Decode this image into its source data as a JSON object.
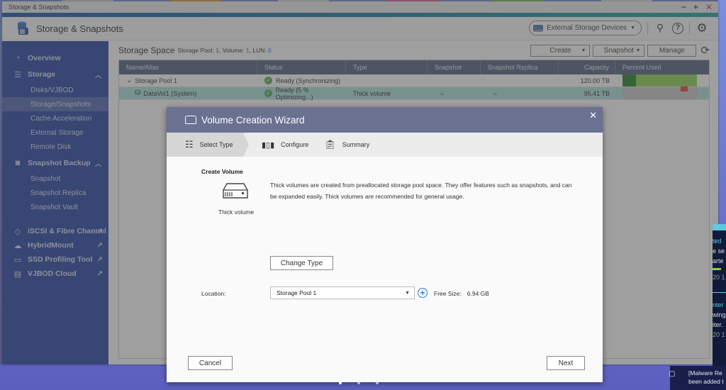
{
  "window": {
    "title": "Storage & Snapshots",
    "controls": {
      "minimize": "−",
      "maximize": "+",
      "close": "✕"
    }
  },
  "header": {
    "app_title": "Storage & Snapshots",
    "external_devices_label": "External Storage Devices",
    "icons": [
      "diagnostics-icon",
      "help-icon",
      "settings-icon"
    ]
  },
  "sidebar": {
    "overview": "Overview",
    "storage": "Storage",
    "storage_items": [
      "Disks/VJBOD",
      "Storage/Snapshots",
      "Cache Acceleration",
      "External Storage",
      "Remote Disk"
    ],
    "snapshot_backup": "Snapshot Backup",
    "snapshot_items": [
      "Snapshot",
      "Snapshot Replica",
      "Snapshot Vault"
    ],
    "external_tools": [
      "iSCSI & Fibre Channel",
      "HybridMount",
      "SSD Profiling Tool",
      "VJBOD Cloud"
    ],
    "active_item": "Storage/Snapshots"
  },
  "content": {
    "title": "Storage Space",
    "summary_prefix_pool": "Storage Pool:",
    "pool_count": "1",
    "summary_volume": ", Volume:",
    "volume_count": "1",
    "summary_lun": ", LUN:",
    "lun_count": "0",
    "toolbar": {
      "create": "Create",
      "snapshot": "Snapshot",
      "manage": "Manage"
    },
    "columns": [
      "Name/Alias",
      "Status",
      "Type",
      "Snapshot",
      "Snapshot Replica",
      "Capacity",
      "Percent Used"
    ],
    "rows": [
      {
        "name": "Storage Pool 1",
        "status": "Ready (Synchronizing)",
        "type": "",
        "snapshot": "",
        "replica": "",
        "capacity": "120.00 TB",
        "percent_used": 0.18,
        "bar_fill": 1.0
      },
      {
        "name": "DataVol1 (System)",
        "status": "Ready (5 % Optimizing...)",
        "type": "Thick volume",
        "snapshot": "–",
        "replica": "–",
        "capacity": "95.41 TB",
        "marker": 0.78
      }
    ]
  },
  "wizard": {
    "title": "Volume Creation Wizard",
    "steps": [
      "Select Type",
      "Configure",
      "Summary"
    ],
    "active_step": "Select Type",
    "section_label": "Create Volume",
    "volume_type": "Thick volume",
    "description": "Thick volumes are created from preallocated storage pool space. They offer features such as snapshots, and can be expanded easily. Thick volumes are recommended for general usage.",
    "change_type_label": "Change Type",
    "location_label": "Location:",
    "location_value": "Storage Pool 1",
    "free_size_label": "Free Size:",
    "free_size_value": "6.94 GB",
    "cancel_label": "Cancel",
    "next_label": "Next"
  },
  "notifications": {
    "toast_text": "[Malware Re… been added t…",
    "toast_line1": "[Malware Re",
    "toast_line2": "been added t"
  }
}
